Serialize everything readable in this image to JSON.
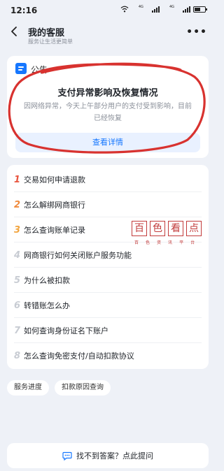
{
  "status_bar": {
    "time": "12:16",
    "signal_tag": "4G"
  },
  "header": {
    "title": "我的客服",
    "subtitle": "服务让生活更简单"
  },
  "notice": {
    "label": "公告",
    "title": "支付异常影响及恢复情况",
    "body": "因网络异常，今天上午部分用户的支付受到影响，目前已经恢复",
    "detail_label": "查看详情",
    "annotation_color": "#d8322f"
  },
  "faq": {
    "items": [
      {
        "number": "1",
        "text": "交易如何申请退款",
        "color": "#e8553f"
      },
      {
        "number": "2",
        "text": "怎么解绑网商银行",
        "color": "#f08a3c"
      },
      {
        "number": "3",
        "text": "怎么查询账单记录",
        "color": "#f2a540"
      },
      {
        "number": "4",
        "text": "网商银行如何关闭账户服务功能",
        "color": "#c8ccd3"
      },
      {
        "number": "5",
        "text": "为什么被扣款",
        "color": "#c8ccd3"
      },
      {
        "number": "6",
        "text": "转错账怎么办",
        "color": "#c8ccd3"
      },
      {
        "number": "7",
        "text": "如何查询身份证名下账户",
        "color": "#c8ccd3"
      },
      {
        "number": "8",
        "text": "怎么查询免密支付/自动扣款协议",
        "color": "#c8ccd3"
      }
    ]
  },
  "watermark": {
    "chars": [
      "百",
      "色",
      "看",
      "点"
    ],
    "sub": [
      "百",
      "色",
      "资",
      "讯",
      "平",
      "台"
    ]
  },
  "tags": [
    "服务进度",
    "扣款原因查询"
  ],
  "ask": {
    "label": "找不到答案？点此提问"
  },
  "colors": {
    "accent": "#1677ff",
    "background": "#eef1f7"
  }
}
